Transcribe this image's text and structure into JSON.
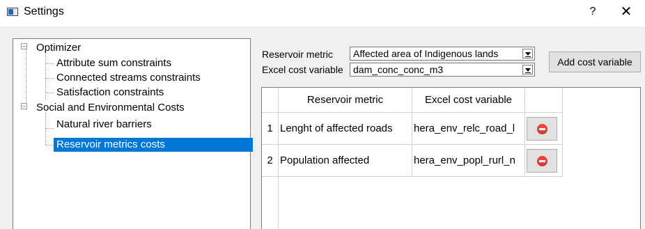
{
  "window": {
    "title": "Settings",
    "help_label": "?",
    "close_label": "✕"
  },
  "tree": {
    "items": [
      {
        "label": "Optimizer",
        "expanded": true
      },
      {
        "label": "Attribute sum constraints"
      },
      {
        "label": "Connected streams constraints"
      },
      {
        "label": "Satisfaction constraints"
      },
      {
        "label": "Social and Environmental Costs",
        "expanded": true
      },
      {
        "label": "Natural river barriers"
      },
      {
        "label": "Reservoir metrics costs",
        "selected": true
      }
    ]
  },
  "form": {
    "reservoir_metric_label": "Reservoir metric",
    "reservoir_metric_value": "Affected area of Indigenous lands",
    "excel_cost_variable_label": "Excel cost variable",
    "excel_cost_variable_value": "dam_conc_conc_m3",
    "add_button_label": "Add cost variable"
  },
  "table": {
    "columns": [
      "Reservoir metric",
      "Excel cost variable"
    ],
    "rows": [
      {
        "index": "1",
        "metric": "Lenght of affected roads",
        "variable": "hera_env_relc_road_l"
      },
      {
        "index": "2",
        "metric": "Population affected",
        "variable": "hera_env_popl_rurl_n"
      }
    ]
  },
  "icons": {
    "app": "window-icon",
    "remove": "remove-icon"
  },
  "colors": {
    "selection": "#0078d7",
    "remove_icon": "#e8443a"
  }
}
